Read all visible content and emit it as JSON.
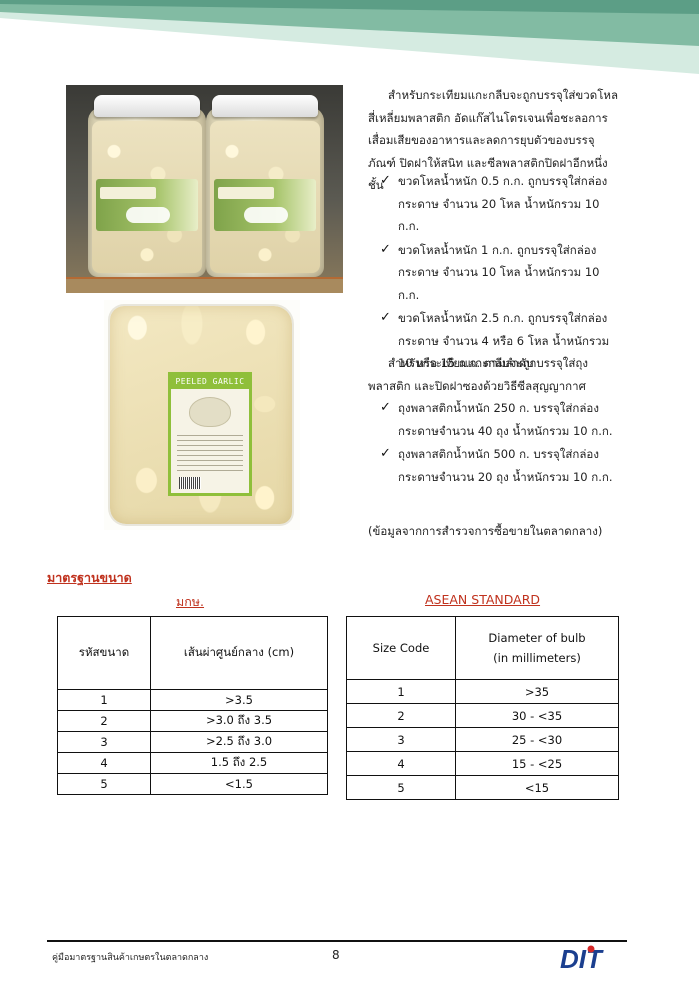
{
  "intro": {
    "text": "สำหรับกระเทียมแกะกลีบจะถูกบรรจุใส่ขวดโหลสี่เหลี่ยมพลาสติก อัดแก๊สไนโตรเจนเพื่อชะลอการเสื่อมเสียของอาหารและลดการยุบตัวของบรรจุภัณฑ์ ปิดฝาให้สนิท และซีลพลาสติกปิดฝาอีกหนึ่งชั้น"
  },
  "jar_items": [
    "ขวดโหลน้ำหนัก 0.5 ก.ก. ถูกบรรจุใส่กล่องกระดาษ จำนวน 20 โหล น้ำหนักรวม 10 ก.ก.",
    "ขวดโหลน้ำหนัก 1 ก.ก. ถูกบรรจุใส่กล่องกระดาษ จำนวน 10 โหล น้ำหนักรวม 10 ก.ก.",
    "ขวดโหลน้ำหนัก 2.5 ก.ก. ถูกบรรจุใส่กล่องกระดาษ จำนวน 4 หรือ 6 โหล น้ำหนักรวม 10 หรือ 15 ก.ก. ตามลำดับ"
  ],
  "bag_intro": "สำหรับกระเทียมแกะกลีบจะถูกบรรจุใส่ถุงพลาสติก และปิดฝาซองด้วยวิธีซีลสุญญากาศ",
  "bag_items": [
    "ถุงพลาสติกน้ำหนัก 250 ก. บรรจุใส่กล่องกระดาษจำนวน 40 ถุง น้ำหนักรวม 10 ก.ก.",
    "ถุงพลาสติกน้ำหนัก 500 ก. บรรจุใส่กล่องกระดาษจำนวน 20 ถุง น้ำหนักรวม 10 ก.ก."
  ],
  "source": "(ข้อมูลจากการสำรวจการซื้อขายในตลาดกลาง)",
  "section_heading": "มาตรฐานขนาด",
  "bag_label_text": "PEELED GARLIC",
  "table_mokor": {
    "title": "มกษ.",
    "headers": [
      "รหัสขนาด",
      "เส้นผ่าศูนย์กลาง (cm)"
    ],
    "rows": [
      [
        "1",
        ">3.5"
      ],
      [
        "2",
        ">3.0 ถึง 3.5"
      ],
      [
        "3",
        ">2.5 ถึง 3.0"
      ],
      [
        "4",
        "1.5 ถึง 2.5"
      ],
      [
        "5",
        "<1.5"
      ]
    ]
  },
  "table_asean": {
    "title": "ASEAN STANDARD",
    "headers": [
      "Size Code",
      "Diameter of bulb",
      "(in millimeters)"
    ],
    "rows": [
      [
        "1",
        ">35"
      ],
      [
        "2",
        "30 - <35"
      ],
      [
        "3",
        "25 - <30"
      ],
      [
        "4",
        "15 - <25"
      ],
      [
        "5",
        "<15"
      ]
    ]
  },
  "footer": {
    "text": "คู่มือมาตรฐานสินค้าเกษตรในตลาดกลาง",
    "page": "8",
    "logo_text": "DIT"
  },
  "colors": {
    "banner_dark": "#7fb8a0",
    "banner_light": "#cfe6db",
    "heading_red": "#c0321e",
    "logo_blue": "#1b3f8f",
    "logo_red": "#d62828"
  }
}
